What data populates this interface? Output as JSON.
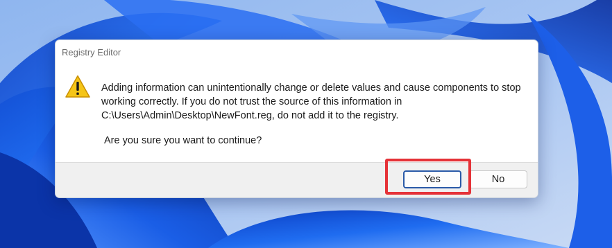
{
  "window": {
    "title": "Registry Editor"
  },
  "dialog": {
    "icon": "warning-icon",
    "message": "Adding information can unintentionally change or delete values and cause components to stop working correctly. If you do not trust the source of this information in C:\\Users\\Admin\\Desktop\\NewFont.reg, do not add it to the registry.",
    "question": "Are you sure you want to continue?"
  },
  "buttons": {
    "yes_label": "Yes",
    "no_label": "No"
  },
  "annotation": {
    "highlight_target": "yes-button",
    "highlight_color": "#e53238"
  },
  "colors": {
    "wallpaper_accent": "#1b5be0",
    "warning_fill": "#f5c518"
  }
}
